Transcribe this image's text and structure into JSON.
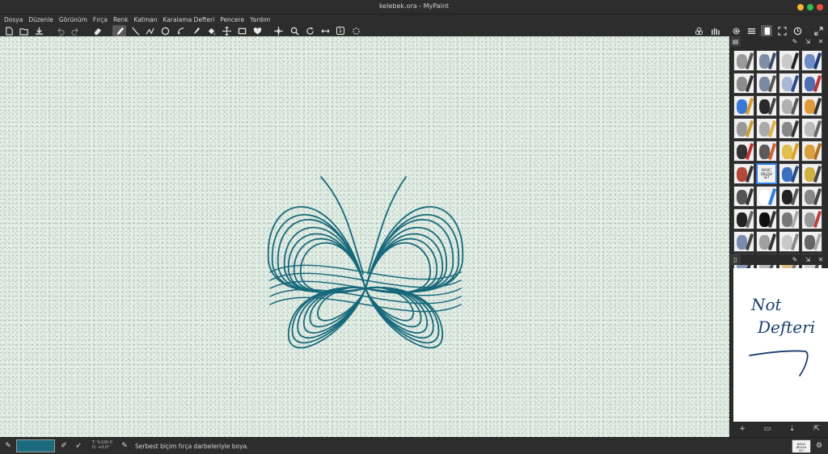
{
  "window": {
    "title": "kelebek.ora - MyPaint",
    "controls": [
      "minimize",
      "maximize",
      "close"
    ]
  },
  "menu": [
    "Dosya",
    "Düzenle",
    "Görünüm",
    "Fırça",
    "Renk",
    "Katman",
    "Karalama Defteri",
    "Pencere",
    "Yardım"
  ],
  "toolbar_icons": {
    "left": [
      "new-file-icon",
      "open-file-icon",
      "save-file-icon",
      "undo-icon",
      "redo-icon",
      "eraser-icon",
      "freehand-brush-icon",
      "inking-icon",
      "connected-lines-icon",
      "ellipse-icon",
      "contour-fill-icon",
      "color-picker-icon",
      "flood-fill-icon",
      "move-layer-icon",
      "frame-icon",
      "symmetry-icon",
      "pan-icon",
      "zoom-icon",
      "rotate-icon",
      "mirror-icon",
      "reset-view-icon",
      "fit-view-icon"
    ],
    "right": [
      "color-sliders-icon",
      "brush-settings-icon",
      "settings-gear-icon",
      "layers-icon",
      "scratchpad-icon",
      "fullscreen-icon",
      "color-wheel-icon",
      "expand-icon"
    ]
  },
  "zoom_reset_label": "1",
  "canvas": {
    "stroke_color": "#17697a",
    "paper_color": "#e3eee3"
  },
  "brush_panel": {
    "selected_index": 21,
    "selected_brush_text": [
      "BASIC",
      "BRUSH",
      "SET"
    ],
    "brush_count": 40
  },
  "scratchpad": {
    "handwritten_text": [
      "Not",
      "Defteri"
    ],
    "tool_icons": [
      "add-icon",
      "open-icon",
      "save-icon",
      "export-icon"
    ]
  },
  "statusbar": {
    "color_hex": "#1c6a7e",
    "coord_line_1": "T: %100.0",
    "coord_line_2": "D: +0.0°",
    "message": "Serbest biçim fırça darbeleriyle boya.",
    "current_brush_text": [
      "BASIC",
      "BRUSH",
      "SET"
    ]
  }
}
